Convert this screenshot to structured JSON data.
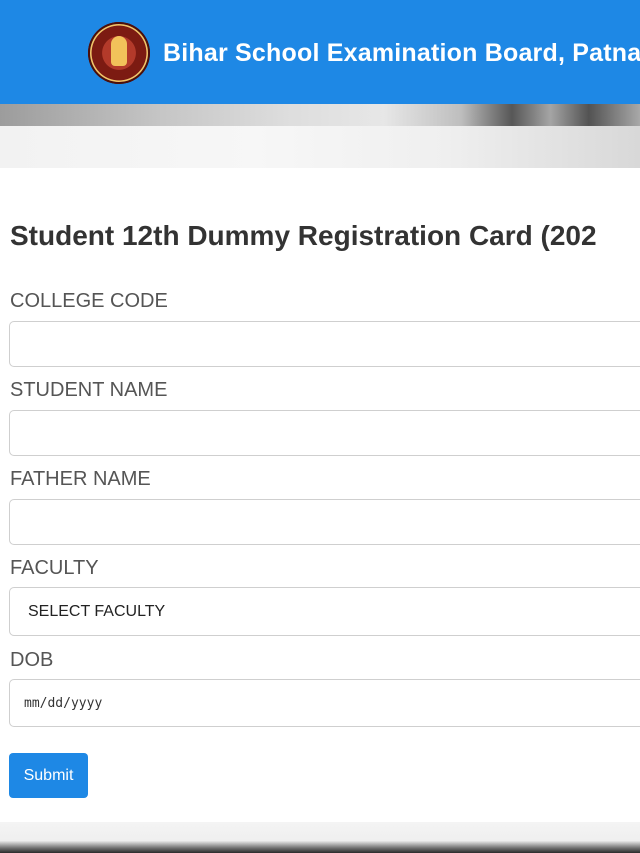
{
  "header": {
    "title": "Bihar School Examination Board, Patna",
    "background": "#1e88e5"
  },
  "form": {
    "title": "Student 12th Dummy Registration Card (202",
    "fields": [
      {
        "label": "COLLEGE CODE",
        "value": ""
      },
      {
        "label": "STUDENT NAME",
        "value": ""
      },
      {
        "label": "FATHER NAME",
        "value": ""
      },
      {
        "label": "FACULTY",
        "value": "SELECT FACULTY"
      },
      {
        "label": "DOB",
        "value": "mm/dd/yyyy"
      }
    ],
    "submit_label": "Submit"
  },
  "icons": {
    "logo": "bseb-emblem-icon"
  }
}
